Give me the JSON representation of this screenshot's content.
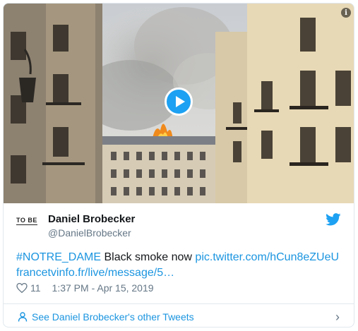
{
  "tweet": {
    "author_name": "Daniel Brobecker",
    "author_handle": "@DanielBrobecker",
    "avatar_text": "TO BE",
    "hashtag": "#NOTRE_DAME",
    "body_text": " Black smoke now ",
    "pic_link": "pic.twitter.com/hCun8eZUeU",
    "second_link": "francetvinfo.fr/live/message/5…",
    "likes": "11",
    "timestamp": "1:37 PM - Apr 15, 2019",
    "see_more": "See Daniel Brobecker's other Tweets",
    "info_glyph": "i"
  },
  "colors": {
    "link": "#1b95e0",
    "play_button": "#1da1f2",
    "muted": "#657786",
    "text": "#14171a"
  },
  "icons": {
    "media_play": "play-icon",
    "brand": "twitter-bird-icon",
    "like": "heart-icon",
    "profile": "person-icon",
    "more": "chevron-right-icon"
  }
}
